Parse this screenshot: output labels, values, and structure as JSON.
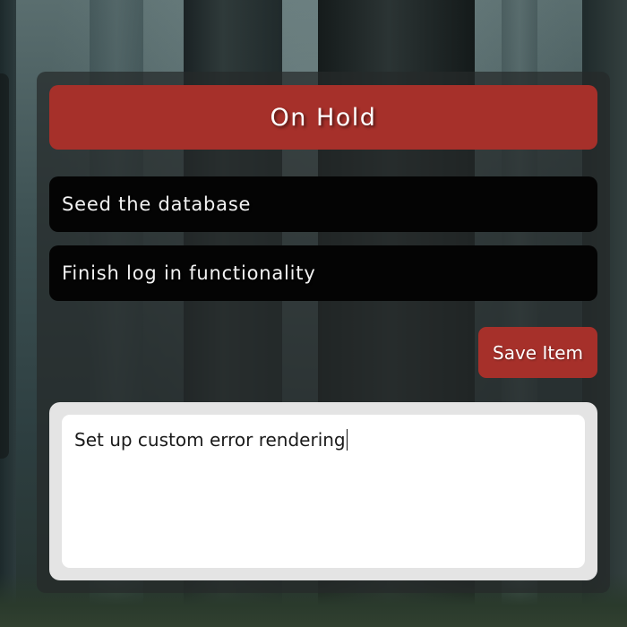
{
  "column": {
    "title": "On Hold",
    "tasks": [
      {
        "text": "Seed the database"
      },
      {
        "text": "Finish log in functionality"
      }
    ]
  },
  "form": {
    "save_label": "Save Item",
    "input_value": "Set up custom error rendering"
  },
  "colors": {
    "accent": "#a6302a",
    "task_bg": "#040404",
    "card_bg": "#262a2a",
    "input_frame": "#e4e4e4"
  }
}
